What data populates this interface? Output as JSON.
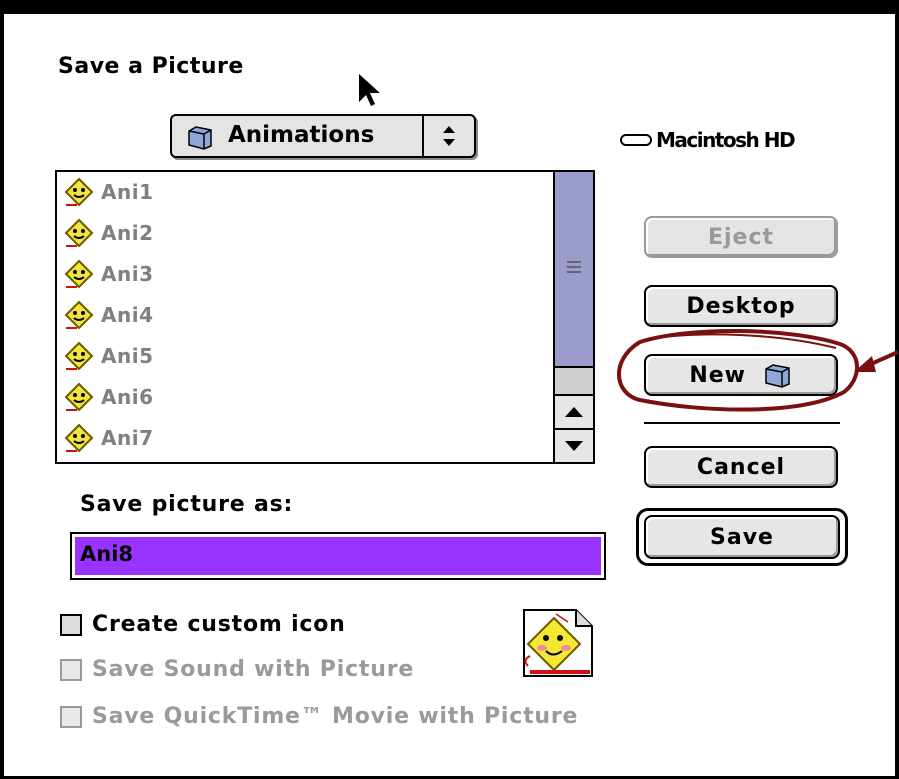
{
  "dialog": {
    "title": "Save a Picture"
  },
  "folder_popup": {
    "selected": "Animations",
    "icon": "folder-icon"
  },
  "disk": {
    "name": "Macintosh HD",
    "icon": "hard-drive-icon"
  },
  "file_list": {
    "items": [
      {
        "label": "Ani1",
        "icon": "picture-file-icon"
      },
      {
        "label": "Ani2",
        "icon": "picture-file-icon"
      },
      {
        "label": "Ani3",
        "icon": "picture-file-icon"
      },
      {
        "label": "Ani4",
        "icon": "picture-file-icon"
      },
      {
        "label": "Ani5",
        "icon": "picture-file-icon"
      },
      {
        "label": "Ani6",
        "icon": "picture-file-icon"
      },
      {
        "label": "Ani7",
        "icon": "picture-file-icon"
      }
    ]
  },
  "buttons": {
    "eject": "Eject",
    "desktop": "Desktop",
    "new": "New",
    "cancel": "Cancel",
    "save": "Save"
  },
  "save_as": {
    "label": "Save picture as:",
    "value": "Ani8"
  },
  "options": {
    "custom_icon": "Create custom icon",
    "save_sound": "Save Sound with Picture",
    "save_movie": "Save QuickTime™ Movie with Picture"
  },
  "colors": {
    "selection": "#9933ff",
    "scroll_thumb": "#9c9ccc",
    "annotation": "#7a1010"
  }
}
